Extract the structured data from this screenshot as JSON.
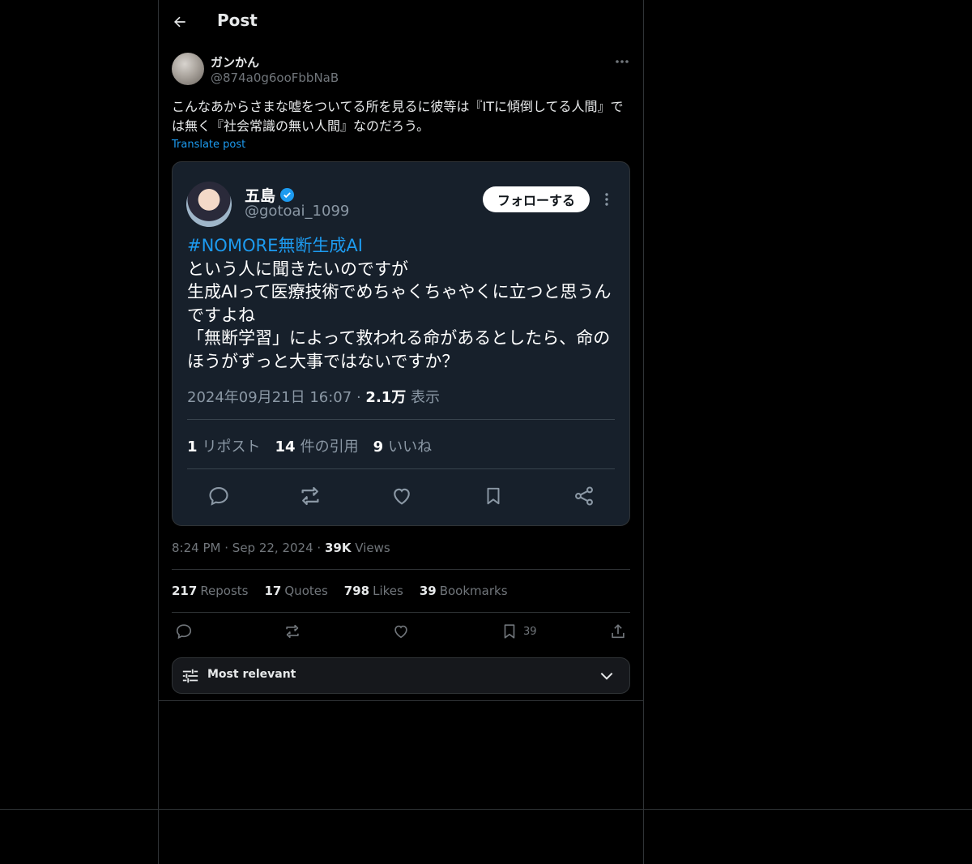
{
  "header": {
    "title": "Post"
  },
  "post": {
    "author_name": "ガンかん",
    "author_handle": "@874a0g6ooFbbNaB",
    "text": "こんなあからさまな嘘をついてる所を見るに彼等は『ITに傾倒してる人間』では無く『社会常識の無い人間』なのだろう。",
    "translate_label": "Translate post",
    "time": "8:24 PM",
    "date": "Sep 22, 2024",
    "views_count": "39K",
    "views_label": "Views",
    "sep": "·"
  },
  "embedded": {
    "name": "五島",
    "handle": "@gotoai_1099",
    "follow_label": "フォローする",
    "hashtag": "#NOMORE無断生成AI",
    "body_lines": [
      "という人に聞きたいのですが",
      "生成AIって医療技術でめちゃくちゃやくに立つと思うんですよね",
      "「無断学習」によって救われる命があるとしたら、命のほうがずっと大事ではないですか？"
    ],
    "timestamp": "2024年09月21日 16:07",
    "views_count": "2.1万",
    "views_label": "表示",
    "reposts_count": "1",
    "reposts_label": "リポスト",
    "quotes_count": "14",
    "quotes_label": "件の引用",
    "likes_count": "9",
    "likes_label": "いいね"
  },
  "stats": {
    "reposts_count": "217",
    "reposts_label": "Reposts",
    "quotes_count": "17",
    "quotes_label": "Quotes",
    "likes_count": "798",
    "likes_label": "Likes",
    "bookmarks_count": "39",
    "bookmarks_label": "Bookmarks"
  },
  "actions": {
    "bookmark_count": "39"
  },
  "sort": {
    "label": "Most relevant"
  },
  "icons": [
    "back-arrow-icon",
    "more-icon",
    "verified-icon",
    "reply-icon",
    "repost-icon",
    "like-icon",
    "bookmark-icon",
    "share-icon",
    "sort-icon",
    "chevron-down-icon"
  ],
  "colors": {
    "background": "#000000",
    "accent": "#1d9bf0",
    "text": "#e7e9ea",
    "muted": "#71767b",
    "card": "#17202b"
  }
}
